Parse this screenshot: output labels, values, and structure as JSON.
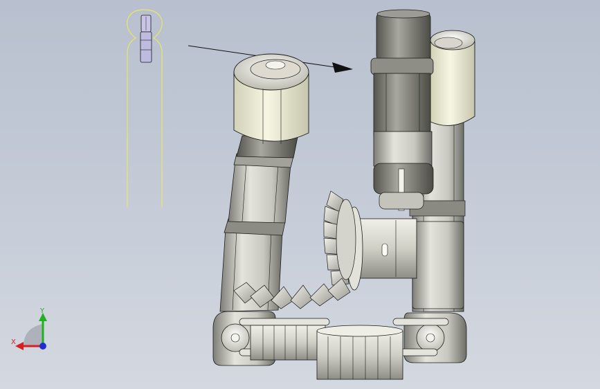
{
  "viewport": {
    "background_top": "#b8c0cf",
    "background_bottom": "#d4d8e0"
  },
  "model": {
    "part_fill": "#e6e6dc",
    "part_shade": "#9a9a92",
    "roller_fill": "#f0f0dc",
    "edge_color": "#1a1a1a",
    "highlight_color": "#e8e860",
    "preview_part_fill": "#c8c6e6"
  },
  "triad": {
    "x_label": "X",
    "y_label": "Y",
    "x_color": "#d42020",
    "y_color": "#20b020",
    "z_color": "#2030d0"
  },
  "icons": {
    "arrow": "arrow-right-icon",
    "triad": "coordinate-triad-icon"
  }
}
